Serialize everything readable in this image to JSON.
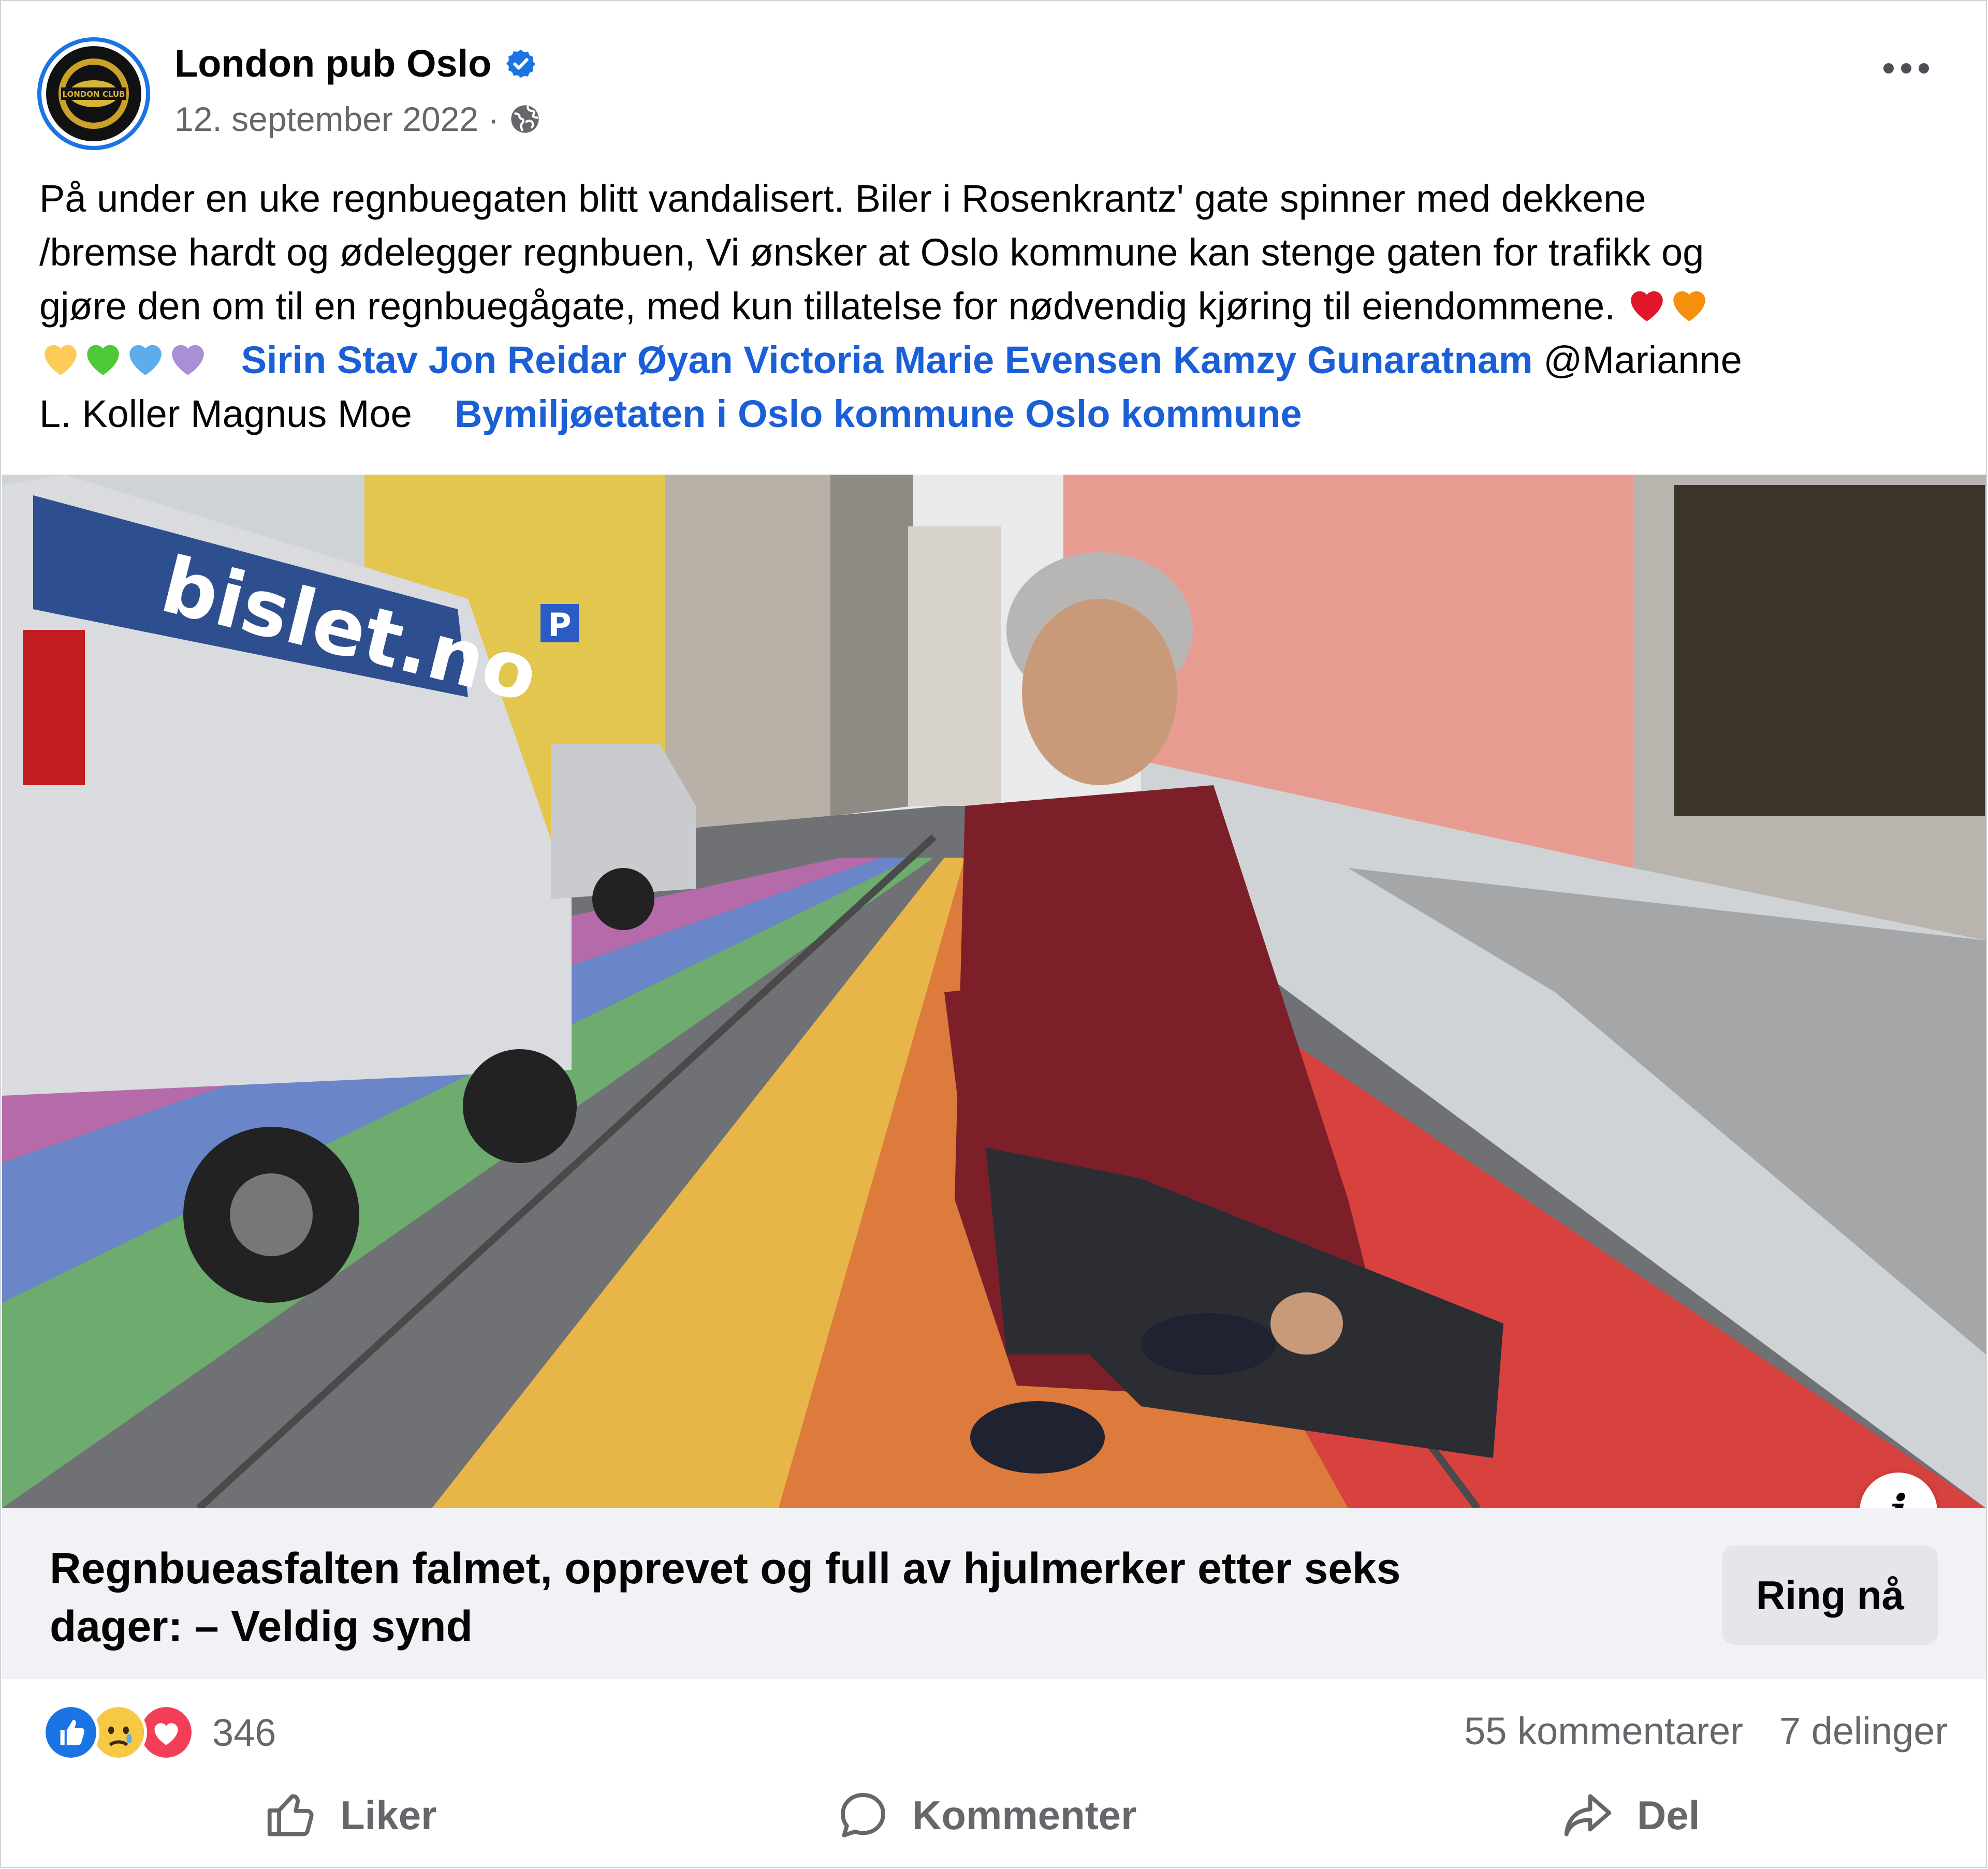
{
  "header": {
    "page_name": "London pub Oslo",
    "avatar_text": "LONDON CLUB",
    "date": "12. september 2022",
    "separator": "·"
  },
  "post": {
    "lines": [
      {
        "segments": [
          {
            "t": "På under en uke regnbuegaten blitt  vandalisert. Biler i Rosenkrantz' gate spinner med dekkene"
          }
        ]
      },
      {
        "segments": [
          {
            "t": "/bremse hardt og ødelegger regnbuen,  Vi ønsker at Oslo kommune kan stenge gaten for trafikk og"
          }
        ]
      },
      {
        "segments": [
          {
            "t": "gjøre den om til en regnbuegågate, med kun tillatelse for nødvendig kjøring til eiendommene. "
          }
        ]
      }
    ],
    "mentions_line1": {
      "tags": [
        "Sirin Stav",
        "Jon Reidar Øyan",
        "Victoria Marie Evensen",
        "Kamzy Gunaratnam"
      ],
      "plain_tail": "@Marianne"
    },
    "mentions_line2": {
      "plain_head": "L. Koller  Magnus Moe",
      "tags": [
        "Bymiljøetaten i Oslo kommune",
        "Oslo kommune"
      ]
    },
    "emoji_hearts": [
      "red-heart",
      "orange-heart",
      "yellow-heart",
      "green-heart",
      "blue-heart",
      "purple-heart"
    ],
    "colors": {
      "red": "#e0162b",
      "orange": "#f4900c",
      "yellow": "#fdcb58",
      "green": "#4fc93a",
      "blue": "#5dadec",
      "purple": "#aa8ed6"
    }
  },
  "photo": {
    "van_text": "bislet.no",
    "parking_sign": "P",
    "description_icon": "info-icon"
  },
  "link_preview": {
    "title_line1": "Regnbueasfalten falmet, opprevet og full av hjulmerker etter seks",
    "title_line2": "dager: – Veldig synd",
    "call_button": "Ring nå",
    "info_label": "i"
  },
  "stats": {
    "reaction_count": "346",
    "comments": "55 kommentarer",
    "shares": "7 delinger"
  },
  "actions": {
    "like": "Liker",
    "comment": "Kommenter",
    "share": "Del"
  },
  "theme": {
    "link_blue": "#1b5fd6",
    "secondary_text": "#65676b",
    "verified_blue": "#1b74e4"
  }
}
